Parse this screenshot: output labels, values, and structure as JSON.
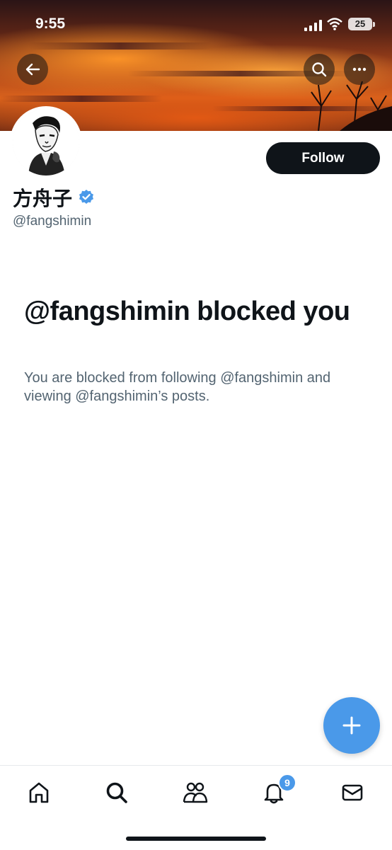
{
  "status_bar": {
    "time": "9:55",
    "battery": "25"
  },
  "profile": {
    "display_name": "方舟子",
    "handle": "@fangshimin",
    "verified": true,
    "follow_label": "Follow"
  },
  "blocked": {
    "title": "@fangshimin blocked you",
    "description": "You are blocked from following @fangshimin and viewing @fangshimin’s posts."
  },
  "tabbar": {
    "notifications_badge": "9"
  },
  "colors": {
    "accent": "#4a99e9",
    "primary_text": "#0f1419",
    "secondary_text": "#536471"
  },
  "icons": {
    "back": "arrow-left-icon",
    "search": "search-icon",
    "more": "more-horizontal-icon",
    "compose": "plus-icon",
    "home": "home-icon",
    "explore": "search-icon",
    "communities": "people-icon",
    "notifications": "bell-icon",
    "messages": "mail-icon"
  }
}
